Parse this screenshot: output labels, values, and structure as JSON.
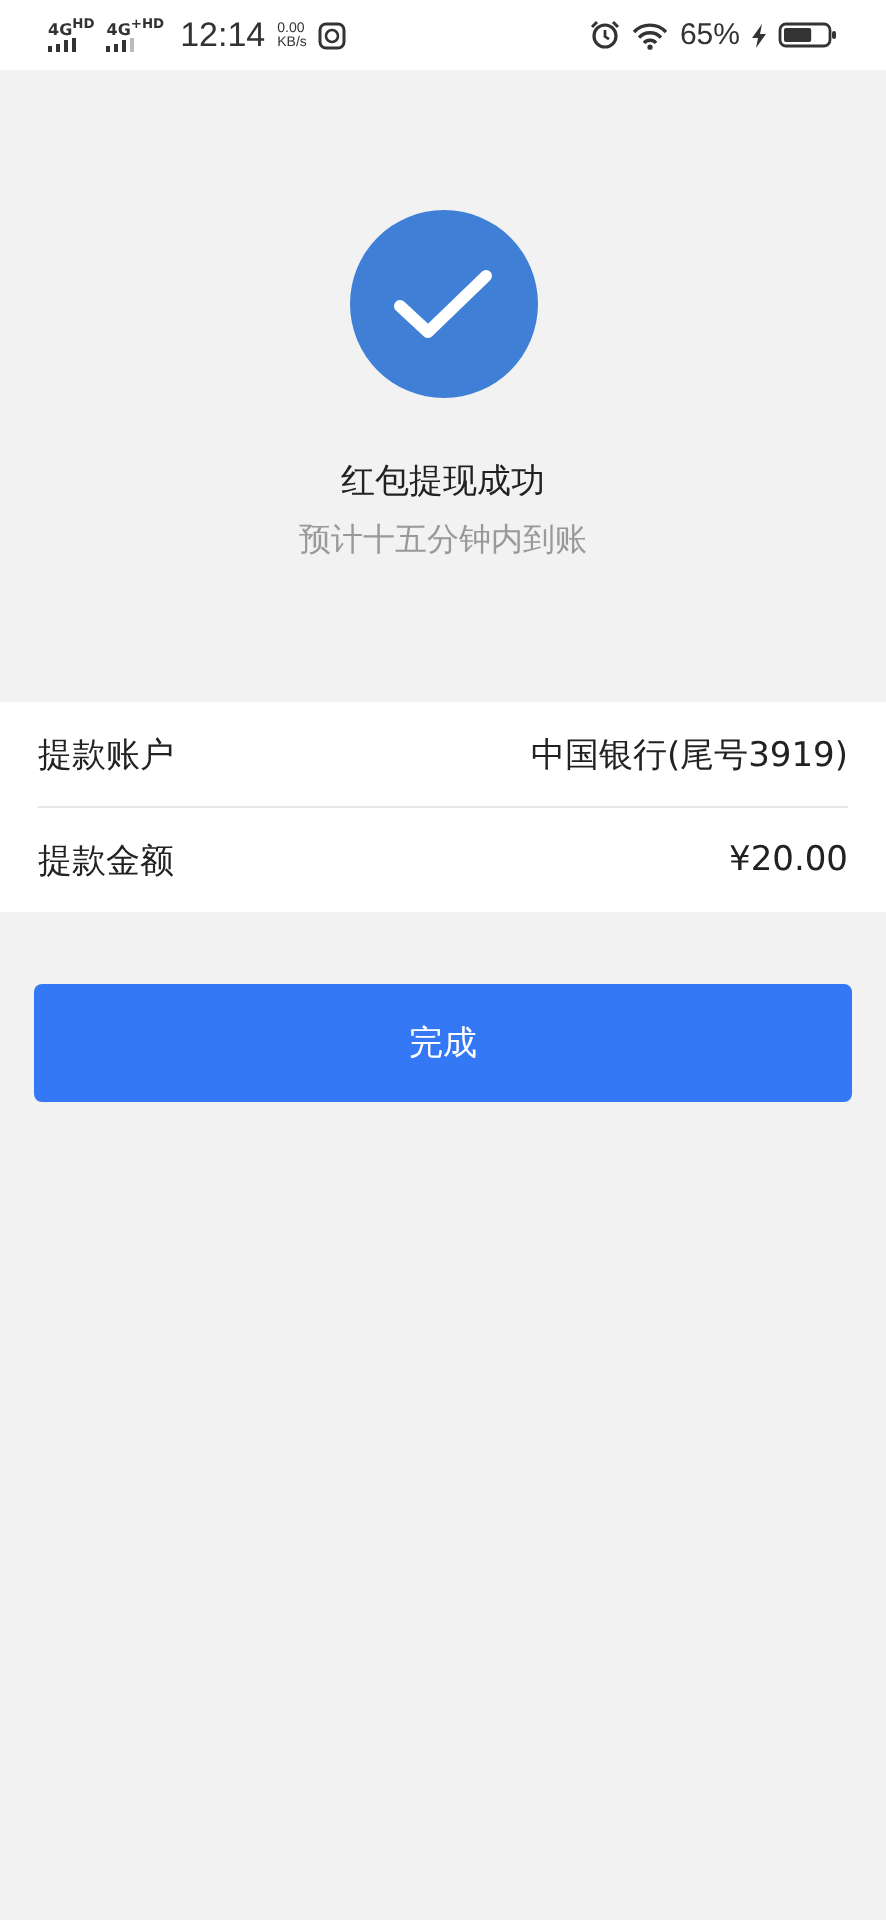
{
  "status_bar": {
    "networks": [
      "4G$^{HD}$",
      "4G$^{+HD}$"
    ],
    "time": "12:14",
    "speed": "0.00",
    "speed_unit": "KB/s",
    "battery": "65%",
    "charging": true
  },
  "result": {
    "title": "红包提现成功",
    "subtitle": "预计十五分钟内到账"
  },
  "details": [
    {
      "label": "提款账户",
      "value": "中国银行(尾号3919)"
    },
    {
      "label": "提款金额",
      "value": "¥20.00"
    }
  ],
  "button": "完成"
}
